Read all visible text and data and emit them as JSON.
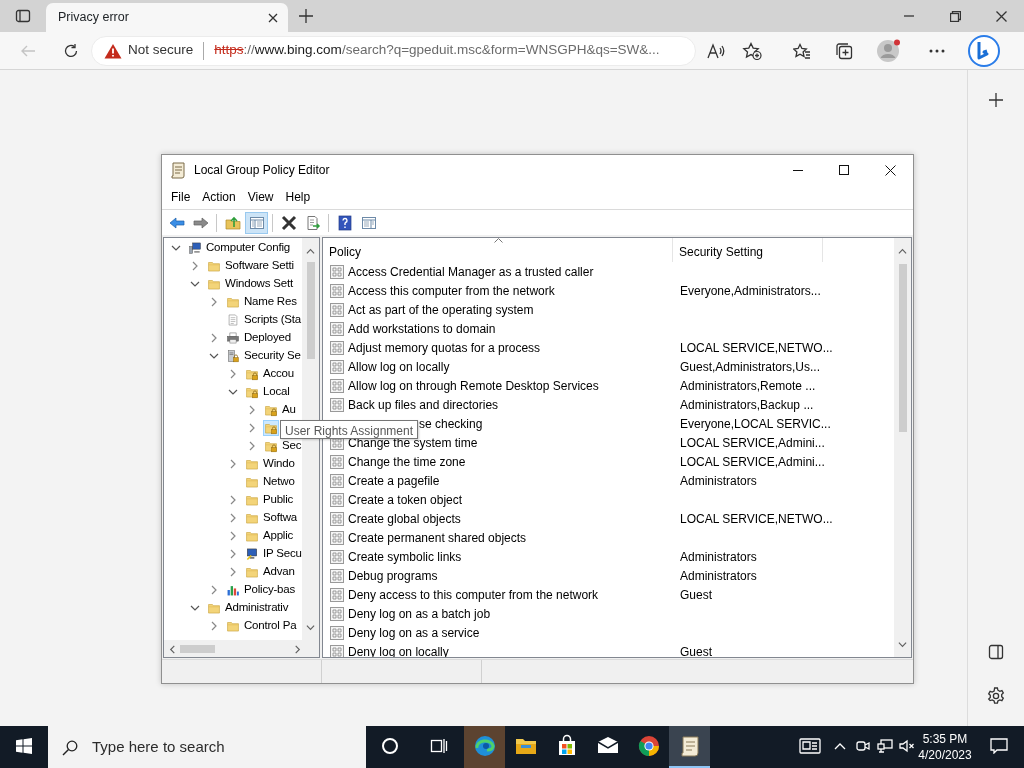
{
  "browser": {
    "tab": {
      "title": "Privacy error"
    },
    "address": {
      "security": "Not secure",
      "parts": [
        "https",
        "://",
        "www.bing.com",
        "/search?q=gpeduit.msc&form=WNSGPH&qs=SW&..."
      ]
    }
  },
  "window": {
    "title": "Local Group Policy Editor",
    "menu": [
      "File",
      "Action",
      "View",
      "Help"
    ],
    "toolbar": [
      {
        "kind": "button",
        "pressed": false
      },
      {
        "kind": "button",
        "pressed": false
      },
      {
        "kind": "separator"
      },
      {
        "kind": "button",
        "pressed": false
      },
      {
        "kind": "button",
        "pressed": true
      },
      {
        "kind": "separator"
      },
      {
        "kind": "button",
        "pressed": false
      },
      {
        "kind": "button",
        "pressed": false
      },
      {
        "kind": "separator"
      },
      {
        "kind": "button",
        "pressed": false
      },
      {
        "kind": "button",
        "pressed": false
      }
    ],
    "tree": [
      {
        "label": "Computer Config",
        "kind": "computer",
        "expanded": true,
        "selected": false,
        "children": [
          {
            "label": "Software Setti",
            "kind": "folder",
            "expanded": false,
            "selected": false
          },
          {
            "label": "Windows Sett",
            "kind": "folder",
            "expanded": true,
            "selected": false,
            "children": [
              {
                "label": "Name Res",
                "kind": "folder",
                "expanded": false,
                "selected": false
              },
              {
                "label": "Scripts (Sta",
                "kind": "scripts",
                "selected": false
              },
              {
                "label": "Deployed",
                "kind": "printer",
                "expanded": false,
                "selected": false
              },
              {
                "label": "Security Se",
                "kind": "security",
                "expanded": true,
                "selected": false,
                "children": [
                  {
                    "label": "Accou",
                    "kind": "lockfolder",
                    "expanded": false,
                    "selected": false
                  },
                  {
                    "label": "Local",
                    "kind": "lockfolder",
                    "expanded": true,
                    "selected": false,
                    "children": [
                      {
                        "label": "Au",
                        "kind": "lockfolder",
                        "expanded": false,
                        "selected": false
                      },
                      {
                        "kind": "lockfolder",
                        "expanded": false,
                        "selected": true
                      },
                      {
                        "label": "Sec",
                        "kind": "lockfolder",
                        "expanded": false,
                        "selected": false
                      }
                    ]
                  },
                  {
                    "label": "Windo",
                    "kind": "folder",
                    "expanded": false,
                    "selected": false
                  },
                  {
                    "label": "Netwo",
                    "kind": "folder",
                    "selected": false
                  },
                  {
                    "label": "Public",
                    "kind": "folder",
                    "expanded": false,
                    "selected": false
                  },
                  {
                    "label": "Softwa",
                    "kind": "folder",
                    "expanded": false,
                    "selected": false
                  },
                  {
                    "label": "Applic",
                    "kind": "folder",
                    "expanded": false,
                    "selected": false
                  },
                  {
                    "label": "IP Secu",
                    "kind": "ipsec",
                    "expanded": false,
                    "selected": false
                  },
                  {
                    "label": "Advan",
                    "kind": "folder",
                    "expanded": false,
                    "selected": false
                  }
                ]
              },
              {
                "label": "Policy-bas",
                "kind": "chart",
                "expanded": false,
                "selected": false
              }
            ]
          },
          {
            "label": "Administrativ",
            "kind": "folder",
            "expanded": true,
            "selected": false,
            "children": [
              {
                "label": "Control Pa",
                "kind": "folder",
                "expanded": false,
                "selected": false
              }
            ]
          }
        ]
      }
    ],
    "tooltip": "User Rights Assignment",
    "list": {
      "columns": [
        "Policy",
        "Security Setting"
      ],
      "rows": [
        {
          "policy": "Access Credential Manager as a trusted caller",
          "covered": false
        },
        {
          "policy": "Access this computer from the network",
          "setting": "Everyone,Administrators...",
          "covered": false
        },
        {
          "policy": "Act as part of the operating system",
          "covered": false
        },
        {
          "policy": "Add workstations to domain",
          "covered": false
        },
        {
          "policy": "Adjust memory quotas for a process",
          "setting": "LOCAL SERVICE,NETWO...",
          "covered": false
        },
        {
          "policy": "Allow log on locally",
          "setting": "Guest,Administrators,Us...",
          "covered": false
        },
        {
          "policy": "Allow log on through Remote Desktop Services",
          "setting": "Administrators,Remote ...",
          "covered": false
        },
        {
          "policy": "Back up files and directories",
          "setting": "Administrators,Backup ...",
          "covered": false
        },
        {
          "policy": "se checking",
          "setting": "Everyone,LOCAL SERVIC...",
          "covered": true
        },
        {
          "policy": "Change the system time",
          "setting": "LOCAL SERVICE,Admini...",
          "covered": false
        },
        {
          "policy": "Change the time zone",
          "setting": "LOCAL SERVICE,Admini...",
          "covered": false
        },
        {
          "policy": "Create a pagefile",
          "setting": "Administrators",
          "covered": false
        },
        {
          "policy": "Create a token object",
          "covered": false
        },
        {
          "policy": "Create global objects",
          "setting": "LOCAL SERVICE,NETWO...",
          "covered": false
        },
        {
          "policy": "Create permanent shared objects",
          "covered": false
        },
        {
          "policy": "Create symbolic links",
          "setting": "Administrators",
          "covered": false
        },
        {
          "policy": "Debug programs",
          "setting": "Administrators",
          "covered": false
        },
        {
          "policy": "Deny access to this computer from the network",
          "setting": "Guest",
          "covered": false
        },
        {
          "policy": "Deny log on as a batch job",
          "covered": false
        },
        {
          "policy": "Deny log on as a service",
          "covered": false
        },
        {
          "policy": "Deny log on locally",
          "setting": "Guest",
          "covered": false
        }
      ]
    }
  },
  "taskbar": {
    "search_placeholder": "Type here to search",
    "apps": [
      {
        "highlighted": true,
        "open": false
      },
      {
        "highlighted": false,
        "open": false
      },
      {
        "highlighted": false,
        "open": false
      },
      {
        "highlighted": false,
        "open": false
      },
      {
        "highlighted": false,
        "open": false
      },
      {
        "highlighted": false,
        "open": true
      }
    ],
    "time": "5:35 PM",
    "date": "4/20/2023"
  }
}
